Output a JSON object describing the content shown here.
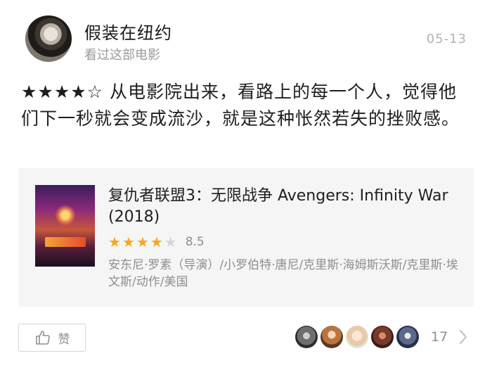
{
  "user": {
    "name": "假装在纽约",
    "action": "看过这部电影",
    "date": "05-13"
  },
  "review": {
    "text": "★★★★☆ 从电影院出来，看路上的每一个人，觉得他们下一秒就会变成流沙，就是这种怅然若失的挫败感。"
  },
  "movie": {
    "title": "复仇者联盟3：无限战争 Avengers: Infinity War (2018)",
    "rating_stars": 4,
    "score": "8.5",
    "meta": "安东尼·罗素（导演）/小罗伯特·唐尼/克里斯·海姆斯沃斯/克里斯·埃文斯/动作/美国"
  },
  "footer": {
    "like_label": "赞",
    "like_count": "17"
  },
  "colors": {
    "star": "#f5a623",
    "muted": "#8f8f8f",
    "card_bg": "#f5f5f5"
  }
}
